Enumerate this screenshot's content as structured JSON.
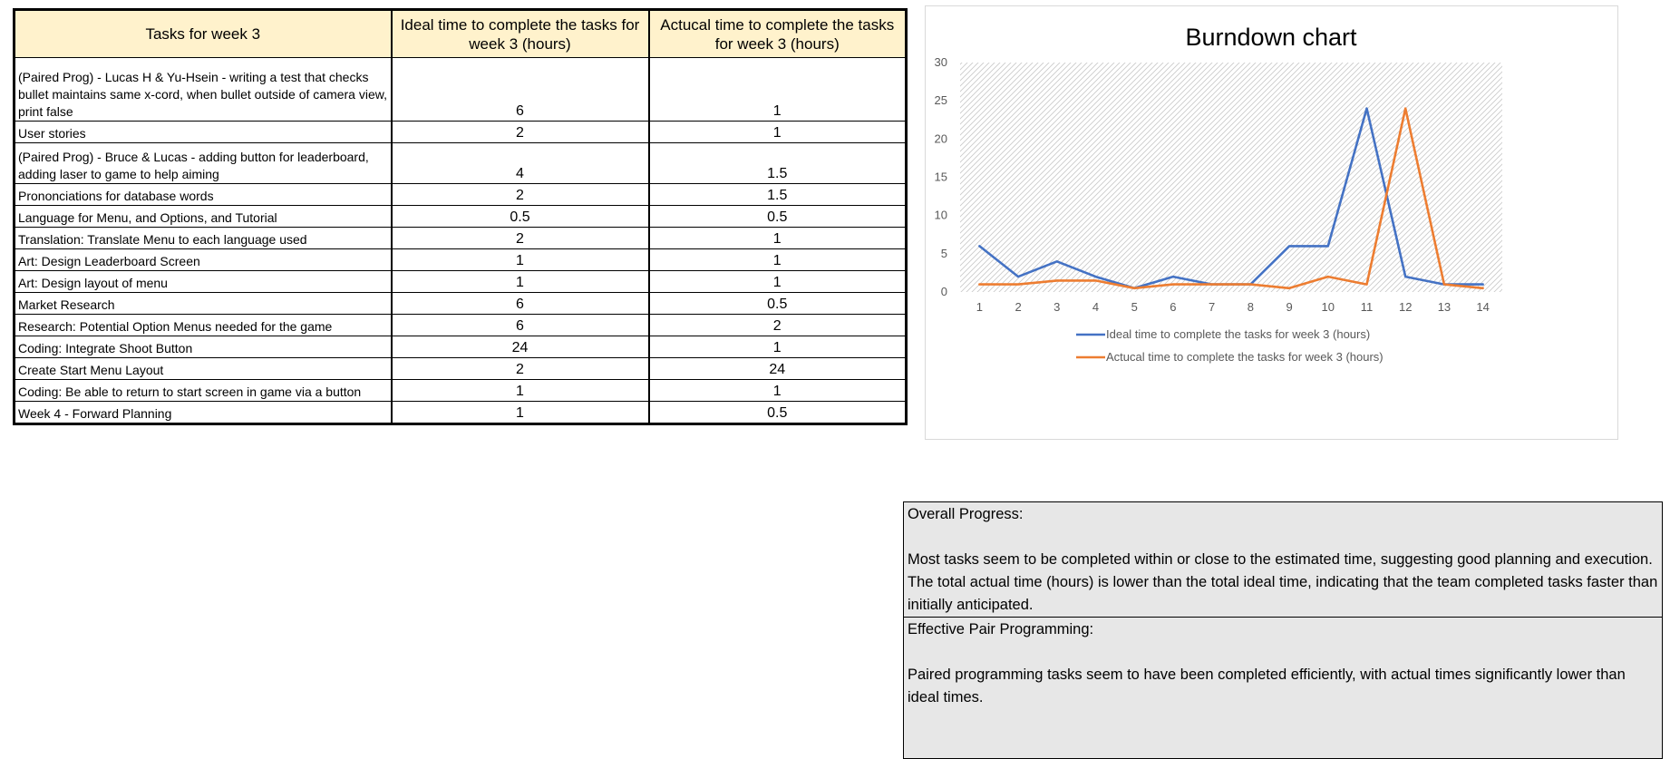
{
  "table": {
    "headers": {
      "task": "Tasks for week 3",
      "ideal": "Ideal time to complete the tasks for week 3 (hours)",
      "actual": "Actucal time to complete the tasks for week 3 (hours)"
    },
    "rows": [
      {
        "task": "(Paired Prog) - Lucas H & Yu-Hsein - writing a test that checks bullet maintains same x-cord, when bullet outside of camera view, print false",
        "ideal": "6",
        "actual": "1"
      },
      {
        "task": "User stories",
        "ideal": "2",
        "actual": "1"
      },
      {
        "task": "(Paired Prog) - Bruce & Lucas - adding button for leaderboard, adding laser to game to help aiming",
        "ideal": "4",
        "actual": "1.5"
      },
      {
        "task": "Prononciations for database words",
        "ideal": "2",
        "actual": "1.5"
      },
      {
        "task": "Language for Menu, and Options, and Tutorial",
        "ideal": "0.5",
        "actual": "0.5"
      },
      {
        "task": "Translation: Translate Menu to each language used",
        "ideal": "2",
        "actual": "1"
      },
      {
        "task": "Art: Design Leaderboard Screen",
        "ideal": "1",
        "actual": "1"
      },
      {
        "task": "Art: Design layout of menu",
        "ideal": "1",
        "actual": "1"
      },
      {
        "task": "Market Research",
        "ideal": "6",
        "actual": "0.5"
      },
      {
        "task": "Research: Potential Option Menus needed for the game",
        "ideal": "6",
        "actual": "2"
      },
      {
        "task": "Coding: Integrate Shoot Button",
        "ideal": "24",
        "actual": "1"
      },
      {
        "task": "Create Start Menu Layout",
        "ideal": "2",
        "actual": "24"
      },
      {
        "task": "Coding: Be able to return to start screen in game via a button",
        "ideal": "1",
        "actual": "1"
      },
      {
        "task": "Week 4 - Forward Planning",
        "ideal": "1",
        "actual": "0.5"
      }
    ]
  },
  "chart_data": {
    "type": "line",
    "title": "Burndown chart",
    "x": [
      1,
      2,
      3,
      4,
      5,
      6,
      7,
      8,
      9,
      10,
      11,
      12,
      13,
      14
    ],
    "ylim": [
      0,
      30
    ],
    "yticks": [
      0,
      5,
      10,
      15,
      20,
      25,
      30
    ],
    "grid": false,
    "plot_background": "diagonal hatch",
    "legend_position": "bottom",
    "series": [
      {
        "name": "Ideal time to complete the tasks for week 3 (hours)",
        "color": "#4472c4",
        "values": [
          6,
          2,
          4,
          2,
          0.5,
          2,
          1,
          1,
          6,
          6,
          24,
          2,
          1,
          1
        ]
      },
      {
        "name": "Actucal time to complete the tasks for week 3 (hours)",
        "color": "#ed7d31",
        "values": [
          1,
          1,
          1.5,
          1.5,
          0.5,
          1,
          1,
          1,
          0.5,
          2,
          1,
          24,
          1,
          0.5
        ]
      }
    ]
  },
  "notes": {
    "overall": {
      "heading": "Overall Progress:",
      "lines": [
        "Most tasks seem to be completed within or close to the estimated time, suggesting good planning and execution.",
        "The total actual time (hours) is lower than the total ideal time, indicating that the team completed tasks faster than initially anticipated."
      ]
    },
    "pair": {
      "heading": "Effective Pair Programming:",
      "lines": [
        "Paired programming tasks seem to have been completed efficiently, with actual times significantly lower than ideal times."
      ]
    }
  }
}
